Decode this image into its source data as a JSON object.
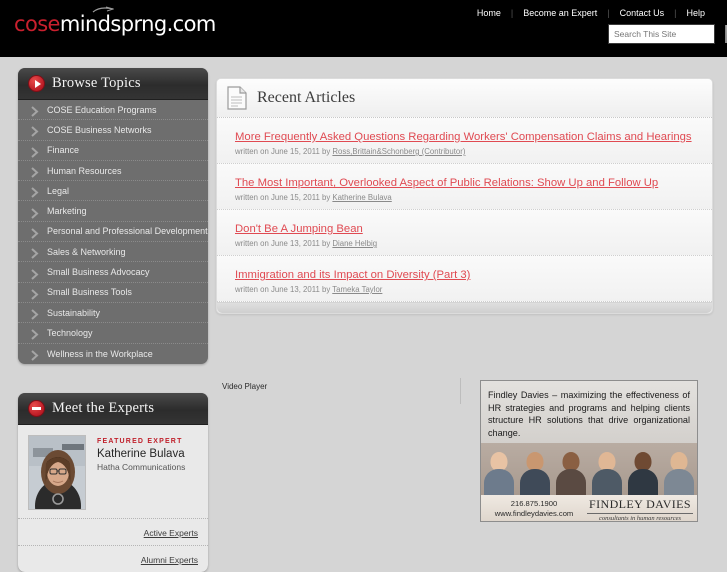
{
  "header": {
    "logo_cose": "cose",
    "logo_rest": "mindsprng.com",
    "nav": [
      {
        "label": "Home"
      },
      {
        "label": "Become an Expert"
      },
      {
        "label": "Contact Us"
      },
      {
        "label": "Help"
      }
    ],
    "search_placeholder": "Search This Site",
    "search_value": ""
  },
  "sidebar": {
    "browse": {
      "title": "Browse Topics",
      "icon": "play-circle-icon",
      "items": [
        {
          "label": "COSE Education Programs"
        },
        {
          "label": "COSE Business Networks"
        },
        {
          "label": "Finance"
        },
        {
          "label": "Human Resources"
        },
        {
          "label": "Legal"
        },
        {
          "label": "Marketing"
        },
        {
          "label": "Personal and Professional Development"
        },
        {
          "label": "Sales & Networking"
        },
        {
          "label": "Small Business Advocacy"
        },
        {
          "label": "Small Business Tools"
        },
        {
          "label": "Sustainability"
        },
        {
          "label": "Technology"
        },
        {
          "label": "Wellness in the Workplace"
        }
      ]
    },
    "experts": {
      "title": "Meet the Experts",
      "icon": "minus-circle-icon",
      "featured_label": "FEATURED EXPERT",
      "name": "Katherine Bulava",
      "organization": "Hatha Communications",
      "links": [
        {
          "label": "Active Experts"
        },
        {
          "label": "Alumni Experts"
        }
      ]
    }
  },
  "main": {
    "recent_articles": {
      "title": "Recent Articles",
      "icon": "document-icon",
      "articles": [
        {
          "title": "More Frequently Asked Questions Regarding Workers' Compensation Claims and Hearings",
          "byline_prefix": "written on June 15, 2011 by ",
          "author": "Ross,Brittain&Schonberg (Contributor)"
        },
        {
          "title": "The Most Important, Overlooked Aspect of Public Relations: Show Up and Follow Up",
          "byline_prefix": "written on June 15, 2011 by ",
          "author": "Katherine Bulava"
        },
        {
          "title": "Don't Be A Jumping Bean",
          "byline_prefix": "written on June 13, 2011 by ",
          "author": "Diane Helbig"
        },
        {
          "title": "Immigration and its Impact on Diversity (Part 3)",
          "byline_prefix": "written on June 13, 2011 by ",
          "author": "Tameka Taylor"
        }
      ]
    },
    "video_player_label": "Video Player"
  },
  "advertisement": {
    "body": "Findley Davies – maximizing the effectiveness of HR strategies and programs and helping clients structure HR solutions that drive organizational change.",
    "phone": "216.875.1900",
    "website": "www.findleydavies.com",
    "brand": "FINDLEY DAVIES",
    "tagline": "consultants in human resources"
  },
  "colors": {
    "brand_red": "#c9202e",
    "link_red": "#e04a52",
    "header_black": "#000000",
    "sidebar_gray": "#6e6e6e",
    "page_bg": "#d5d5d5"
  }
}
